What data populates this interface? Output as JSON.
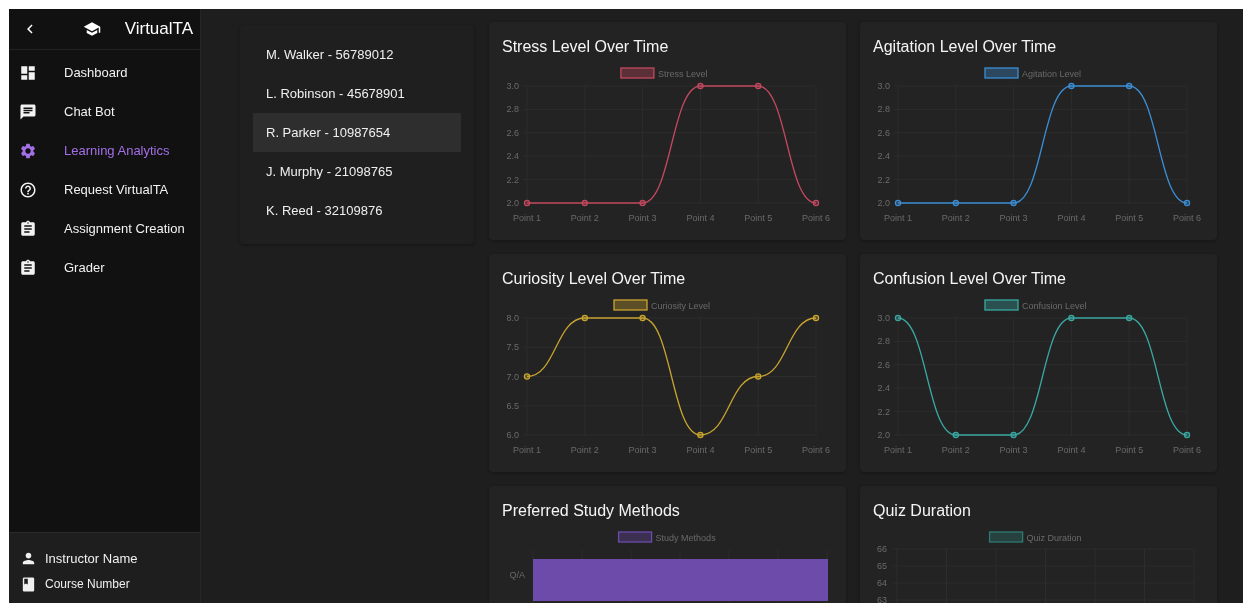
{
  "sidebar": {
    "brand": "VirtualTA",
    "items": [
      {
        "label": "Dashboard",
        "selected": false
      },
      {
        "label": "Chat Bot",
        "selected": false
      },
      {
        "label": "Learning Analytics",
        "selected": true
      },
      {
        "label": "Request VirtualTA",
        "selected": false
      },
      {
        "label": "Assignment Creation",
        "selected": false
      },
      {
        "label": "Grader",
        "selected": false
      }
    ],
    "footer": [
      {
        "kind": "person",
        "label": "Instructor Name"
      },
      {
        "kind": "book",
        "label": "Course Number"
      }
    ]
  },
  "students": [
    {
      "label": "M. Walker - 56789012",
      "selected": false
    },
    {
      "label": "L. Robinson - 45678901",
      "selected": false
    },
    {
      "label": "R. Parker - 10987654",
      "selected": true
    },
    {
      "label": "J. Murphy - 21098765",
      "selected": false
    },
    {
      "label": "K. Reed - 32109876",
      "selected": false
    }
  ],
  "panels": [
    {
      "kind": "line",
      "title": "Stress Level Over Time",
      "chart_data": {
        "type": "line",
        "categories": [
          "Point 1",
          "Point 2",
          "Point 3",
          "Point 4",
          "Point 5",
          "Point 6"
        ],
        "grid": true,
        "series": [
          {
            "name": "Stress Level",
            "color": "#c4495f",
            "marker": "circle",
            "values": [
              2,
              2,
              2,
              3,
              3,
              2
            ]
          }
        ],
        "ylim": [
          2,
          3
        ],
        "yticks": [
          {
            "value": 2,
            "label": "2.0"
          },
          {
            "value": 2.2,
            "label": "2.2"
          },
          {
            "value": 2.4,
            "label": "2.4"
          },
          {
            "value": 2.6,
            "label": "2.6"
          },
          {
            "value": 2.8,
            "label": "2.8"
          },
          {
            "value": 3,
            "label": "3.0"
          }
        ]
      }
    },
    {
      "kind": "line",
      "title": "Agitation Level Over Time",
      "chart_data": {
        "type": "line",
        "categories": [
          "Point 1",
          "Point 2",
          "Point 3",
          "Point 4",
          "Point 5",
          "Point 6"
        ],
        "grid": true,
        "series": [
          {
            "name": "Agitation Level",
            "color": "#3b8ed4",
            "marker": "circle",
            "values": [
              2,
              2,
              2,
              3,
              3,
              2
            ]
          }
        ],
        "ylim": [
          2,
          3
        ],
        "yticks": [
          {
            "value": 2,
            "label": "2.0"
          },
          {
            "value": 2.2,
            "label": "2.2"
          },
          {
            "value": 2.4,
            "label": "2.4"
          },
          {
            "value": 2.6,
            "label": "2.6"
          },
          {
            "value": 2.8,
            "label": "2.8"
          },
          {
            "value": 3,
            "label": "3.0"
          }
        ]
      }
    },
    {
      "kind": "line",
      "title": "Curiosity Level Over Time",
      "chart_data": {
        "type": "line",
        "categories": [
          "Point 1",
          "Point 2",
          "Point 3",
          "Point 4",
          "Point 5",
          "Point 6"
        ],
        "grid": true,
        "series": [
          {
            "name": "Curiosity Level",
            "color": "#c9a430",
            "marker": "circle",
            "values": [
              7,
              8,
              8,
              6,
              7,
              8
            ]
          }
        ],
        "ylim": [
          6,
          8
        ],
        "yticks": [
          {
            "value": 6,
            "label": "6.0"
          },
          {
            "value": 6.5,
            "label": "6.5"
          },
          {
            "value": 7,
            "label": "7.0"
          },
          {
            "value": 7.5,
            "label": "7.5"
          },
          {
            "value": 8,
            "label": "8.0"
          }
        ]
      }
    },
    {
      "kind": "line",
      "title": "Confusion Level Over Time",
      "chart_data": {
        "type": "line",
        "categories": [
          "Point 1",
          "Point 2",
          "Point 3",
          "Point 4",
          "Point 5",
          "Point 6"
        ],
        "grid": true,
        "series": [
          {
            "name": "Confusion Level",
            "color": "#3aa8a2",
            "marker": "circle",
            "values": [
              3,
              2,
              2,
              3,
              3,
              2
            ]
          }
        ],
        "ylim": [
          2,
          3
        ],
        "yticks": [
          {
            "value": 2,
            "label": "2.0"
          },
          {
            "value": 2.2,
            "label": "2.2"
          },
          {
            "value": 2.4,
            "label": "2.4"
          },
          {
            "value": 2.6,
            "label": "2.6"
          },
          {
            "value": 2.8,
            "label": "2.8"
          },
          {
            "value": 3,
            "label": "3.0"
          }
        ]
      }
    },
    {
      "kind": "hbar",
      "title": "Preferred Study Methods",
      "legend": {
        "label": "Study Methods",
        "color": "#6c4bab"
      },
      "axis_labels": [
        "Q/A"
      ]
    },
    {
      "kind": "grid",
      "title": "Quiz Duration",
      "legend": {
        "label": "Quiz Duration",
        "color": "#2f7a74"
      },
      "axis_labels": [
        "66",
        "65",
        "64",
        "63"
      ]
    }
  ]
}
